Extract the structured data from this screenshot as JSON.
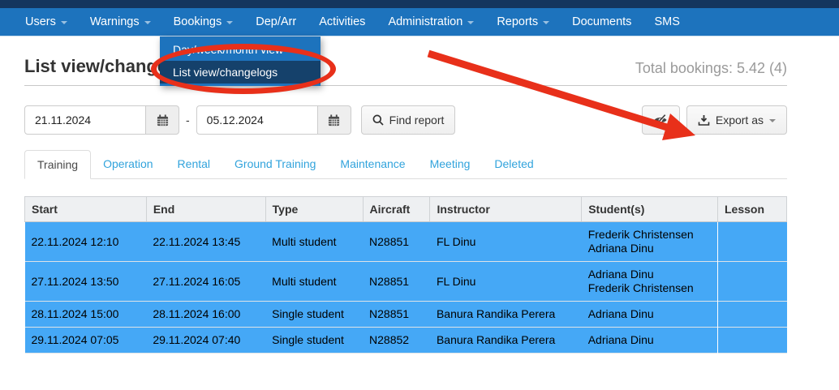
{
  "nav": {
    "items": [
      {
        "label": "Users",
        "has_caret": true
      },
      {
        "label": "Warnings",
        "has_caret": true
      },
      {
        "label": "Bookings",
        "has_caret": true
      },
      {
        "label": "Dep/Arr",
        "has_caret": false
      },
      {
        "label": "Activities",
        "has_caret": false
      },
      {
        "label": "Administration",
        "has_caret": true
      },
      {
        "label": "Reports",
        "has_caret": true
      },
      {
        "label": "Documents",
        "has_caret": false
      },
      {
        "label": "SMS",
        "has_caret": false
      }
    ]
  },
  "bookings_dropdown": {
    "items": [
      {
        "label": "Day/week/month view",
        "active": false
      },
      {
        "label": "List view/changelogs",
        "active": true
      }
    ]
  },
  "page": {
    "title": "List view/changelogs",
    "total_bookings": "Total bookings: 5.42 (4)"
  },
  "filters": {
    "date_from": "21.11.2024",
    "date_to": "05.12.2024",
    "separator": "-",
    "find_report_label": "Find report",
    "export_label": "Export as"
  },
  "tabs": [
    {
      "label": "Training",
      "active": true
    },
    {
      "label": "Operation",
      "active": false
    },
    {
      "label": "Rental",
      "active": false
    },
    {
      "label": "Ground Training",
      "active": false
    },
    {
      "label": "Maintenance",
      "active": false
    },
    {
      "label": "Meeting",
      "active": false
    },
    {
      "label": "Deleted",
      "active": false
    }
  ],
  "table": {
    "columns": [
      "Start",
      "End",
      "Type",
      "Aircraft",
      "Instructor",
      "Student(s)",
      "Lesson"
    ],
    "rows": [
      {
        "start": "22.11.2024 12:10",
        "end": "22.11.2024 13:45",
        "type": "Multi student",
        "aircraft": "N28851",
        "instructor": "FL Dinu",
        "students": [
          "Frederik Christensen",
          "Adriana Dinu"
        ],
        "lesson": ""
      },
      {
        "start": "27.11.2024 13:50",
        "end": "27.11.2024 16:05",
        "type": "Multi student",
        "aircraft": "N28851",
        "instructor": "FL Dinu",
        "students": [
          "Adriana Dinu",
          "Frederik Christensen"
        ],
        "lesson": ""
      },
      {
        "start": "28.11.2024 15:00",
        "end": "28.11.2024 16:00",
        "type": "Single student",
        "aircraft": "N28851",
        "instructor": "Banura Randika Perera",
        "students": [
          "Adriana Dinu"
        ],
        "lesson": ""
      },
      {
        "start": "29.11.2024 07:05",
        "end": "29.11.2024 07:40",
        "type": "Single student",
        "aircraft": "N28852",
        "instructor": "Banura Randika Perera",
        "students": [
          "Adriana Dinu"
        ],
        "lesson": ""
      }
    ]
  },
  "icons": {
    "calendar": "calendar-icon",
    "search": "search-icon",
    "eye_slash": "eye-slash-icon",
    "download": "download-icon",
    "caret_down": "caret-down-icon"
  },
  "colors": {
    "top_strip": "#14365e",
    "navbar": "#1d73bd",
    "dropdown_active_bg": "#15416b",
    "row_highlight": "#45a8f6",
    "tab_link": "#31a3dc",
    "annotation_red": "#e8301a"
  }
}
